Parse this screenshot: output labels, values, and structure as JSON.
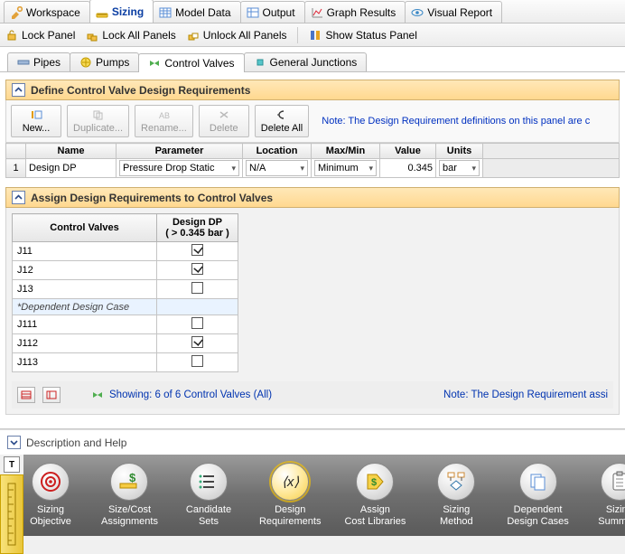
{
  "top_tabs": {
    "workspace": "Workspace",
    "sizing": "Sizing",
    "model_data": "Model Data",
    "output": "Output",
    "graph_results": "Graph Results",
    "visual_report": "Visual Report"
  },
  "toolbar": {
    "lock_panel": "Lock Panel",
    "lock_all": "Lock All Panels",
    "unlock_all": "Unlock All Panels",
    "show_status": "Show Status Panel"
  },
  "sub_tabs": {
    "pipes": "Pipes",
    "pumps": "Pumps",
    "control_valves": "Control Valves",
    "general_junctions": "General Junctions"
  },
  "section": {
    "define": "Define Control Valve Design Requirements",
    "assign": "Assign Design Requirements to Control Valves"
  },
  "actions": {
    "new": "New...",
    "duplicate": "Duplicate...",
    "rename": "Rename...",
    "delete": "Delete",
    "delete_all": "Delete All",
    "note": "Note: The Design Requirement definitions on this panel are c"
  },
  "define_table": {
    "headers": {
      "name": "Name",
      "parameter": "Parameter",
      "location": "Location",
      "maxmin": "Max/Min",
      "value": "Value",
      "units": "Units"
    },
    "row": {
      "idx": "1",
      "name": "Design DP",
      "parameter": "Pressure Drop Static",
      "location": "N/A",
      "maxmin": "Minimum",
      "value": "0.345",
      "units": "bar"
    }
  },
  "assign_table": {
    "headers": {
      "valves": "Control Valves",
      "req_l1": "Design DP",
      "req_l2": "( > 0.345 bar )"
    },
    "rows": [
      {
        "name": "J11",
        "checked": true
      },
      {
        "name": "J12",
        "checked": true
      },
      {
        "name": "J13",
        "checked": false
      }
    ],
    "separator": "*Dependent Design Case",
    "rows2": [
      {
        "name": "J111",
        "checked": false
      },
      {
        "name": "J112",
        "checked": true
      },
      {
        "name": "J113",
        "checked": false
      }
    ]
  },
  "status": {
    "showing": "Showing: 6 of 6 Control Valves (All)",
    "note": "Note: The Design Requirement assi"
  },
  "desc_help": "Description and Help",
  "steps": {
    "sizing_objective": "Sizing\nObjective",
    "size_cost": "Size/Cost\nAssignments",
    "candidate_sets": "Candidate\nSets",
    "design_req": "Design\nRequirements",
    "assign_cost": "Assign\nCost Libraries",
    "sizing_method": "Sizing\nMethod",
    "dependent_dc": "Dependent\nDesign Cases",
    "sizing_summary": "Sizing\nSummary"
  }
}
